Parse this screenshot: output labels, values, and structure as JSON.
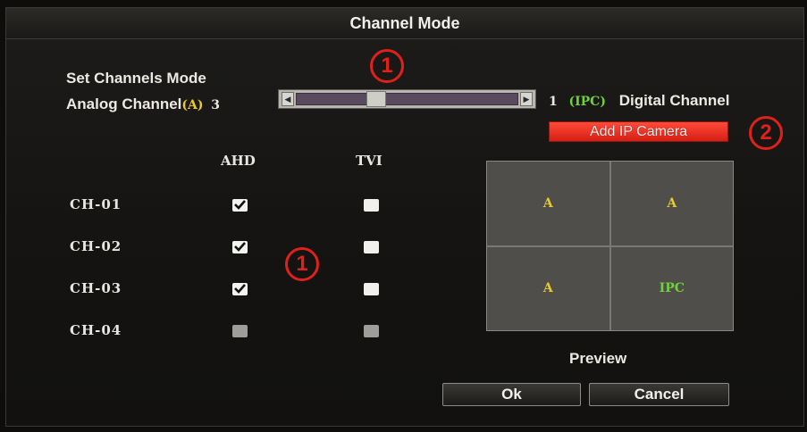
{
  "window": {
    "title": "Channel Mode"
  },
  "mode": {
    "heading": "Set Channels Mode",
    "analog_label": "Analog Channel",
    "analog_tag": "(A)",
    "analog_count": "3",
    "digital_count": "1",
    "digital_tag": "(IPC)",
    "digital_label": "Digital Channel",
    "slider_fraction": 0.35
  },
  "add_ip_button": "Add IP Camera",
  "badges": {
    "b1": "1",
    "b2": "2",
    "b3": "1"
  },
  "table": {
    "col_ahd": "AHD",
    "col_tvi": "TVI",
    "rows": [
      {
        "label": "CH-01",
        "ahd": "checked",
        "tvi": "unchecked"
      },
      {
        "label": "CH-02",
        "ahd": "checked",
        "tvi": "unchecked"
      },
      {
        "label": "CH-03",
        "ahd": "checked",
        "tvi": "unchecked"
      },
      {
        "label": "CH-04",
        "ahd": "disabled",
        "tvi": "disabled"
      }
    ]
  },
  "preview": {
    "label": "Preview",
    "cells": [
      "A",
      "A",
      "A",
      "IPC"
    ]
  },
  "buttons": {
    "ok": "Ok",
    "cancel": "Cancel"
  },
  "colors": {
    "analog": "#e8c92e",
    "digital": "#6fd23a",
    "accent": "#e0211a"
  },
  "icons": {
    "left": "arrow-left-icon",
    "right": "arrow-right-icon",
    "check": "check-icon"
  }
}
